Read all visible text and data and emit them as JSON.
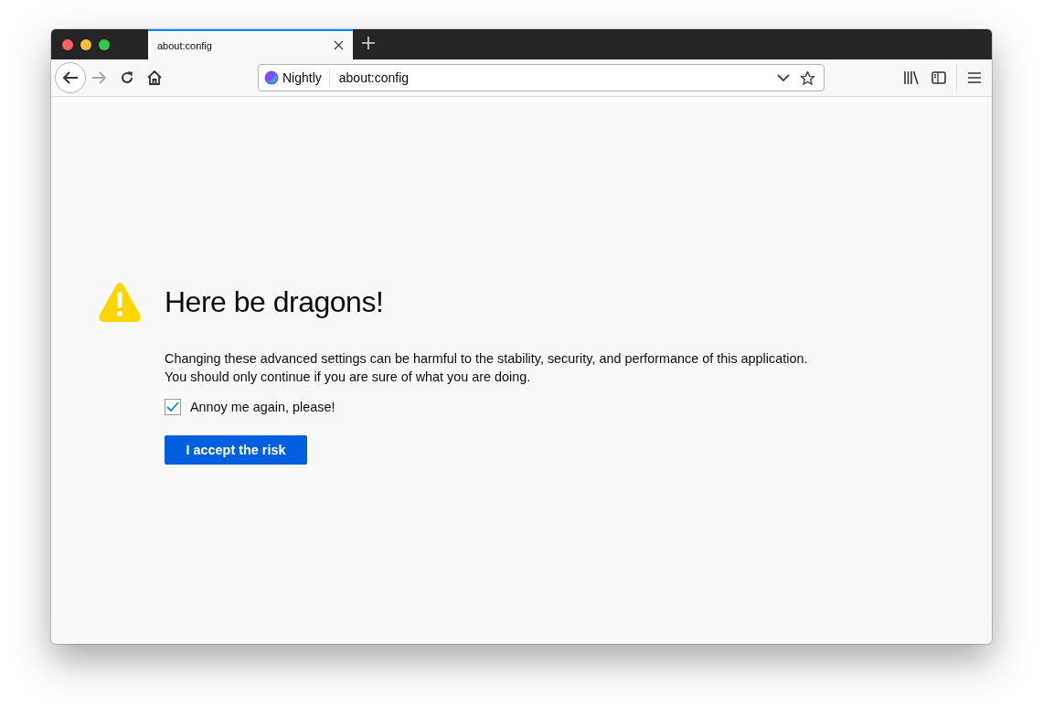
{
  "tabs": [
    {
      "title": "about:config",
      "selected": true
    }
  ],
  "address_bar": {
    "identity": "Nightly",
    "url": "about:config"
  },
  "page": {
    "heading": "Here be dragons!",
    "paragraph": [
      "Changing these advanced settings can be harmful to the stability, security, and performance of this application.",
      "You should only continue if you are sure of what you are doing."
    ],
    "checkbox": {
      "label": "Annoy me again, please!",
      "checked": true
    },
    "button": "I accept the risk"
  }
}
